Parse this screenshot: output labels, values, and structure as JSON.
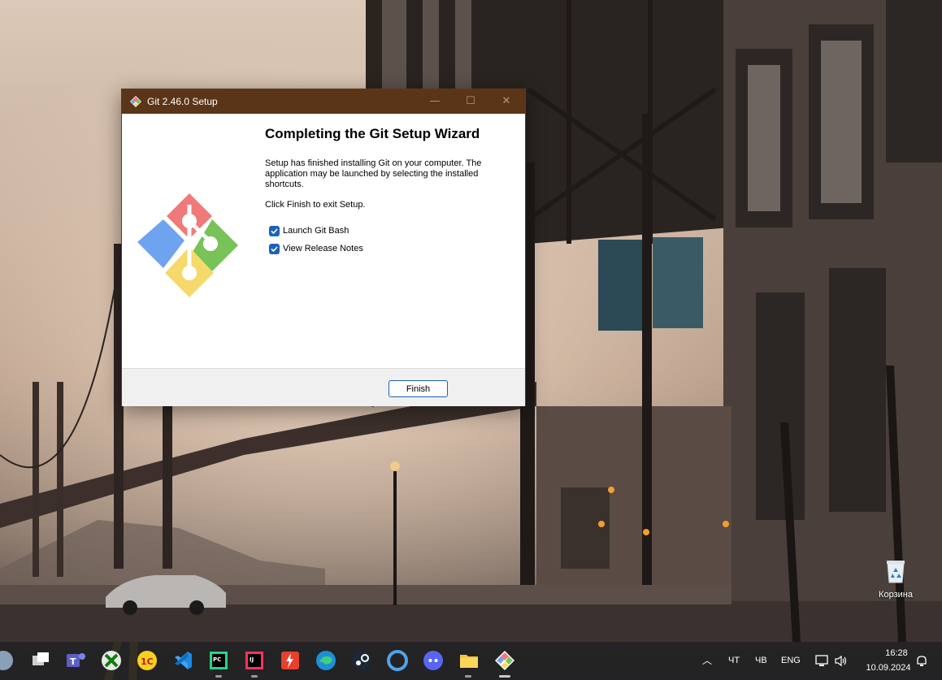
{
  "window": {
    "title": "Git 2.46.0 Setup",
    "min_glyph": "—",
    "max_glyph": "☐",
    "close_glyph": "✕"
  },
  "wizard": {
    "heading": "Completing the Git Setup Wizard",
    "body": "Setup has finished installing Git on your computer. The application may be launched by selecting the installed shortcuts.",
    "finish_hint": "Click Finish to exit Setup.",
    "options": [
      {
        "label": "Launch Git Bash",
        "checked": true
      },
      {
        "label": "View Release Notes",
        "checked": true
      }
    ],
    "finish_button": "Finish"
  },
  "desktop": {
    "recycle_bin_label": "Корзина"
  },
  "taskbar": {
    "apps": [
      "start",
      "task-view",
      "teams",
      "xbox",
      "1c",
      "vscode",
      "pycharm",
      "intellij",
      "burp",
      "edge",
      "steam",
      "cortana",
      "discord",
      "file-explorer",
      "git-setup"
    ],
    "tray": {
      "chevron": "︿",
      "thu": "ЧТ",
      "thu2": "ЧВ",
      "lang": "ENG",
      "time": "16:28",
      "date": "10.09.2024"
    }
  },
  "colors": {
    "titlebar": "#5b3517",
    "accent": "#1b62b8",
    "git_red": "#f07a7a",
    "git_green": "#79c257",
    "git_blue": "#6ea3f0",
    "git_yellow": "#f5da6b"
  }
}
